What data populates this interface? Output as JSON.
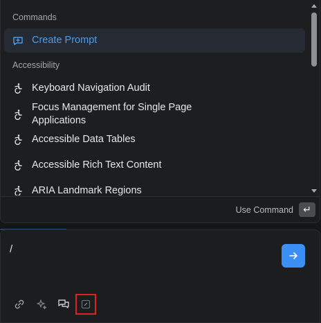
{
  "commands_section": {
    "title": "Commands",
    "items": [
      {
        "label": "Create Prompt",
        "icon": "message-plus-icon",
        "selected": true
      }
    ]
  },
  "accessibility_section": {
    "title": "Accessibility",
    "items": [
      {
        "label": "Keyboard Navigation Audit",
        "icon": "accessibility-icon"
      },
      {
        "label": "Focus Management for Single Page Applications",
        "icon": "accessibility-icon"
      },
      {
        "label": "Accessible Data Tables",
        "icon": "accessibility-icon"
      },
      {
        "label": "Accessible Rich Text Content",
        "icon": "accessibility-icon"
      },
      {
        "label": "ARIA Landmark Regions",
        "icon": "accessibility-icon"
      }
    ]
  },
  "footer": {
    "action_label": "Use Command",
    "key_hint": "↵"
  },
  "input": {
    "value": "/"
  },
  "toolbar": {
    "tools": [
      "link-icon",
      "sparkle-icon",
      "chat-bubbles-icon",
      "edit-square-icon"
    ]
  },
  "colors": {
    "accent": "#3b8ff5",
    "selected_text": "#4a9cf0",
    "highlight_border": "#e02424"
  }
}
